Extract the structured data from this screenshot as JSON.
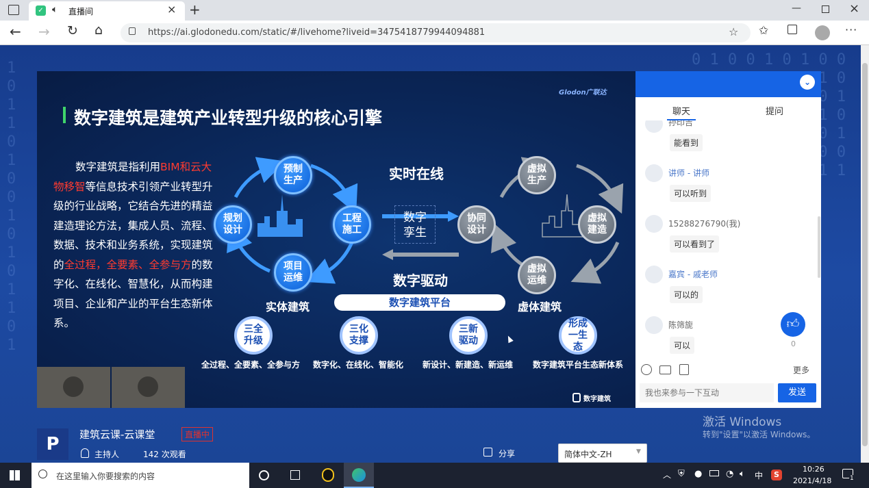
{
  "browser": {
    "tab_title": "直播间",
    "url": "https://ai.glodonedu.com/static/#/livehome?liveid=3475418779944094881"
  },
  "slide": {
    "logo": "Glodon广联达",
    "title": "数字建筑是建筑产业转型升级的核心引擎",
    "paragraph": {
      "p1": "数字建筑是指利用",
      "r1": "BIM和云大物移智",
      "p2": "等信息技术引领产业转型升级的行业战略，它结合先进的精益建造理论方法，集成人员、流程、数据、技术和业务系统，实现建筑的",
      "r2": "全过程，全要素、全参与方",
      "p3": "的数字化、在线化、智慧化，从而构建项目、企业和产业的平台生态新体系。"
    },
    "left_cycle": [
      "预制生产",
      "工程施工",
      "项目运维",
      "规划设计"
    ],
    "right_cycle": [
      "虚拟生产",
      "虚拟建造",
      "虚拟运维",
      "协同设计"
    ],
    "center_box": "数字孪生",
    "arrow_top": "实时在线",
    "arrow_bottom": "数字驱动",
    "label_left": "实体建筑",
    "label_right": "虚体建筑",
    "platform": "数字建筑平台",
    "bottom_circles": [
      "三全升级",
      "三化支撑",
      "三新驱动",
      "形成一生态"
    ],
    "bottom_labels": [
      "全过程、全要素、全参与方",
      "数字化、在线化、智能化",
      "新设计、新建造、新运维",
      "数字建筑平台生态新体系"
    ],
    "brand": "数字建筑"
  },
  "chat": {
    "tabs": [
      "聊天",
      "提问"
    ],
    "messages": [
      {
        "name": "孙印吉",
        "text": "能看到",
        "highlight": false
      },
      {
        "name": "讲师 - 讲师",
        "text": "可以听到",
        "highlight": true
      },
      {
        "name": "15288276790(我)",
        "text": "可以看到了",
        "highlight": false
      },
      {
        "name": "嘉宾 - 戚老师",
        "text": "可以的",
        "highlight": true
      },
      {
        "name": "陈筛旎",
        "text": "可以",
        "highlight": false
      }
    ],
    "like_count": "0",
    "more": "更多",
    "input_placeholder": "我也来参与一下互动",
    "send": "发送"
  },
  "info": {
    "channel": "建筑云课-云课堂",
    "live_badge": "直播中",
    "host": "主持人",
    "views": "142 次观看",
    "share": "分享",
    "language": "简体中文-ZH"
  },
  "watermark": {
    "line1": "激活 Windows",
    "line2": "转到\"设置\"以激活 Windows。"
  },
  "taskbar": {
    "search_placeholder": "在这里输入你要搜索的内容",
    "ime": "中",
    "time": "10:26",
    "date": "2021/4/18",
    "notification_count": "1"
  },
  "colors": {
    "accent": "#1664e5",
    "live_red": "#e0322f",
    "slide_red": "#ff3b30"
  }
}
